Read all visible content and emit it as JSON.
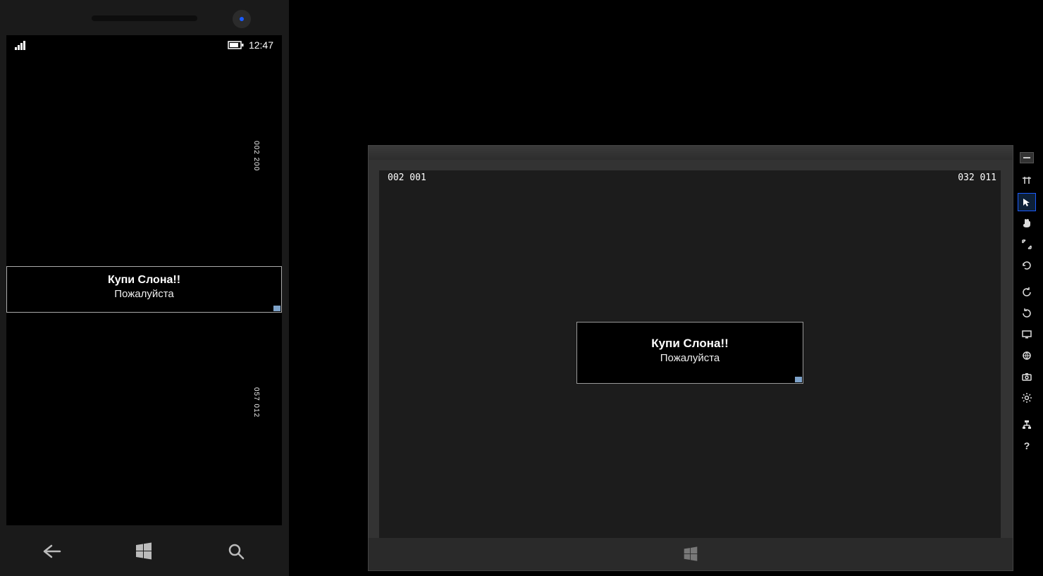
{
  "phone": {
    "status": {
      "time": "12:47"
    },
    "perf": {
      "top": "002  200",
      "bottom": "057  012"
    },
    "ad": {
      "title": "Купи Слона!!",
      "subtitle": "Пожалуйста"
    }
  },
  "tablet": {
    "perf": {
      "left": "002   001",
      "right": "032   011"
    },
    "ad": {
      "title": "Купи Слона!!",
      "subtitle": "Пожалуйста"
    }
  },
  "toolbar": {
    "help_label": "?"
  }
}
